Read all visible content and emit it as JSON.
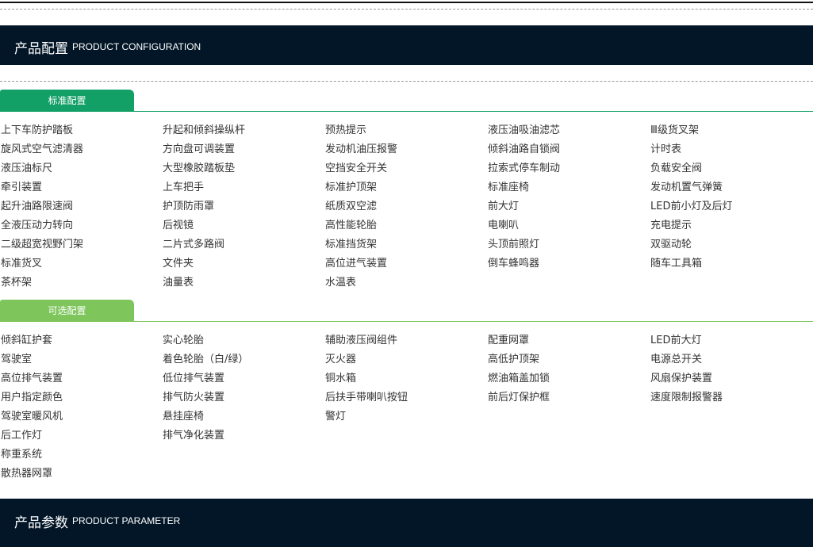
{
  "config_banner": {
    "zh": "产品配置",
    "en": "PRODUCT CONFIGURATION"
  },
  "standard": {
    "tab_label": "标准配置",
    "color": "#13a066",
    "columns": [
      [
        "上下车防护踏板",
        "旋风式空气滤清器",
        "液压油标尺",
        "牵引装置",
        "起升油路限速阀",
        "全液压动力转向",
        "二级超宽视野门架",
        "标准货叉",
        "茶杯架"
      ],
      [
        "升起和倾斜操纵杆",
        "方向盘可调装置",
        "大型橡胶踏板垫",
        "上车把手",
        "护顶防雨罩",
        "后视镜",
        "二片式多路阀",
        "文件夹",
        "油量表"
      ],
      [
        "预热提示",
        "发动机油压报警",
        "空挡安全开关",
        "标准护顶架",
        "纸质双空滤",
        "高性能轮胎",
        "标准挡货架",
        "高位进气装置",
        "水温表"
      ],
      [
        "液压油吸油滤芯",
        "倾斜油路自锁阀",
        "拉索式停车制动",
        "标准座椅",
        "前大灯",
        "电喇叭",
        "头顶前照灯",
        "倒车蜂鸣器"
      ],
      [
        "Ⅲ级货叉架",
        "计时表",
        "负载安全阀",
        "发动机置气弹簧",
        "LED前小灯及后灯",
        "充电提示",
        "双驱动轮",
        "随车工具箱"
      ]
    ]
  },
  "optional": {
    "tab_label": "可选配置",
    "color": "#7ec65c",
    "columns": [
      [
        "倾斜缸护套",
        "驾驶室",
        "高位排气装置",
        "用户指定颜色",
        "驾驶室暖风机",
        "后工作灯",
        "称重系统",
        "散热器网罩"
      ],
      [
        "实心轮胎",
        "着色轮胎（白/绿）",
        "低位排气装置",
        "排气防火装置",
        "悬挂座椅",
        "排气净化装置"
      ],
      [
        "辅助液压阀组件",
        "灭火器",
        "铜水箱",
        "后扶手带喇叭按钮",
        "警灯"
      ],
      [
        "配重网罩",
        "高低护顶架",
        "燃油箱盖加锁",
        "前后灯保护框"
      ],
      [
        "LED前大灯",
        "电源总开关",
        "风扇保护装置",
        "速度限制报警器"
      ]
    ]
  },
  "param_banner": {
    "zh": "产品参数",
    "en": "PRODUCT PARAMETER"
  }
}
